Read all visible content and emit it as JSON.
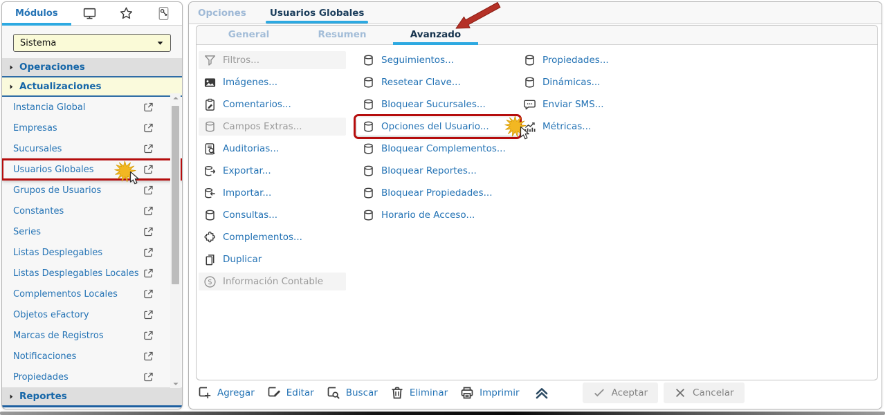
{
  "colors": {
    "accent_underline": "#2da9e1",
    "link_blue": "#2473b5",
    "active_tab_navy": "#1c3e5c",
    "inactive_tab_blue": "#9fb9d6",
    "section_header_blue": "#1566a8",
    "section_gray_bg": "#dedede",
    "section_yellow_bg": "#fafadc",
    "select_yellow_bg": "#fafad7",
    "highlight_red": "#b50d0d",
    "starburst_gold": "#f2b722",
    "disabled_text": "#9b9b9b",
    "disabled_row_bg": "#f4f4f4"
  },
  "sidebar": {
    "tab_label": "Módulos",
    "top_icons": [
      {
        "icon": "monitor-icon"
      },
      {
        "icon": "star-icon"
      },
      {
        "icon": "key-icon"
      }
    ],
    "module_select": {
      "value": "Sistema"
    },
    "sections": [
      {
        "label": "Operaciones",
        "tone": "gray"
      },
      {
        "label": "Actualizaciones",
        "tone": "yellow"
      }
    ],
    "items": [
      {
        "label": "Instancia Global"
      },
      {
        "label": "Empresas"
      },
      {
        "label": "Sucursales"
      },
      {
        "label": "Usuarios Globales",
        "highlight": true,
        "cursor": true
      },
      {
        "label": "Grupos de Usuarios"
      },
      {
        "label": "Constantes"
      },
      {
        "label": "Series"
      },
      {
        "label": "Listas Desplegables"
      },
      {
        "label": "Listas Desplegables Locales"
      },
      {
        "label": "Complementos Locales"
      },
      {
        "label": "Objetos eFactory"
      },
      {
        "label": "Marcas de Registros"
      },
      {
        "label": "Notificaciones"
      },
      {
        "label": "Propiedades"
      }
    ],
    "bottom_sections": [
      {
        "label": "Reportes",
        "tone": "gray"
      }
    ]
  },
  "main": {
    "tabs": [
      {
        "label": "Opciones"
      },
      {
        "label": "Usuarios Globales",
        "active": true
      }
    ],
    "subtabs": [
      {
        "label": "General"
      },
      {
        "label": "Resumen"
      },
      {
        "label": "Avanzado",
        "active": true
      }
    ],
    "menu": {
      "col1": [
        {
          "label": "Filtros...",
          "icon": "filter-icon",
          "disabled": true
        },
        {
          "label": "Imágenes...",
          "icon": "image-icon"
        },
        {
          "label": "Comentarios...",
          "icon": "clipboard-pencil-icon"
        },
        {
          "label": "Campos Extras...",
          "icon": "database-icon",
          "disabled": true
        },
        {
          "label": "Auditorias...",
          "icon": "audit-search-icon"
        },
        {
          "label": "Exportar...",
          "icon": "database-export-icon"
        },
        {
          "label": "Importar...",
          "icon": "database-import-icon"
        },
        {
          "label": "Consultas...",
          "icon": "database-icon"
        },
        {
          "label": "Complementos...",
          "icon": "puzzle-icon"
        },
        {
          "label": "Duplicar",
          "icon": "duplicate-icon"
        },
        {
          "label": "Información Contable",
          "icon": "dollar-circle-icon",
          "disabled": true
        }
      ],
      "col2": [
        {
          "label": "Seguimientos...",
          "icon": "database-icon"
        },
        {
          "label": "Resetear Clave...",
          "icon": "database-icon"
        },
        {
          "label": "Bloquear Sucursales...",
          "icon": "database-icon"
        },
        {
          "label": "Opciones del Usuario...",
          "icon": "database-icon",
          "highlight": true,
          "cursor": true
        },
        {
          "label": "Bloquear Complementos...",
          "icon": "database-icon"
        },
        {
          "label": "Bloquear Reportes...",
          "icon": "database-icon"
        },
        {
          "label": "Bloquear Propiedades...",
          "icon": "database-icon"
        },
        {
          "label": "Horario de Acceso...",
          "icon": "database-icon"
        }
      ],
      "col3": [
        {
          "label": "Propiedades...",
          "icon": "database-icon"
        },
        {
          "label": "Dinámicas...",
          "icon": "database-icon"
        },
        {
          "label": "Enviar SMS...",
          "icon": "sms-bubble-icon"
        },
        {
          "label": "Métricas...",
          "icon": "metrics-chart-icon"
        }
      ]
    },
    "toolbar": {
      "actions": [
        {
          "label": "Agregar",
          "icon": "add-square-icon"
        },
        {
          "label": "Editar",
          "icon": "edit-square-icon"
        },
        {
          "label": "Buscar",
          "icon": "search-square-icon"
        },
        {
          "label": "Eliminar",
          "icon": "trash-icon"
        },
        {
          "label": "Imprimir",
          "icon": "printer-icon"
        }
      ],
      "dialog_buttons": [
        {
          "label": "Aceptar",
          "icon": "check-icon"
        },
        {
          "label": "Cancelar",
          "icon": "x-icon"
        }
      ]
    }
  }
}
